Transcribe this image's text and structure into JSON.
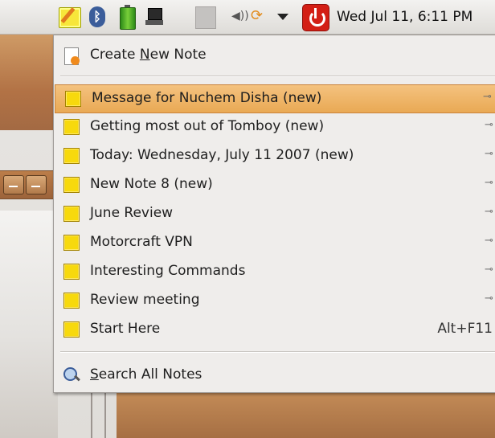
{
  "panel": {
    "clock": "Wed Jul 11,  6:11 PM"
  },
  "menu": {
    "create": {
      "pre": "Create ",
      "mnemonic": "N",
      "post": "ew Note"
    },
    "notes": [
      {
        "label": "Message for Nuchem Disha (new)",
        "accel": "",
        "highlighted": true
      },
      {
        "label": "Getting most out of Tomboy (new)",
        "accel": ""
      },
      {
        "label": "Today: Wednesday, July 11 2007 (new)",
        "accel": ""
      },
      {
        "label": "New Note 8 (new)",
        "accel": ""
      },
      {
        "label": "June Review",
        "accel": ""
      },
      {
        "label": "Motorcraft VPN",
        "accel": ""
      },
      {
        "label": "Interesting Commands",
        "accel": ""
      },
      {
        "label": "Review meeting",
        "accel": ""
      },
      {
        "label": "Start Here",
        "accel": "Alt+F11"
      }
    ],
    "search": {
      "mnemonic": "S",
      "post": "earch All Notes"
    }
  },
  "icons": {
    "pin": "pin-icon",
    "note": "note-icon"
  },
  "colors": {
    "highlight": "#e9a954",
    "note_yellow": "#f7d90d",
    "power_red": "#d31f15"
  }
}
